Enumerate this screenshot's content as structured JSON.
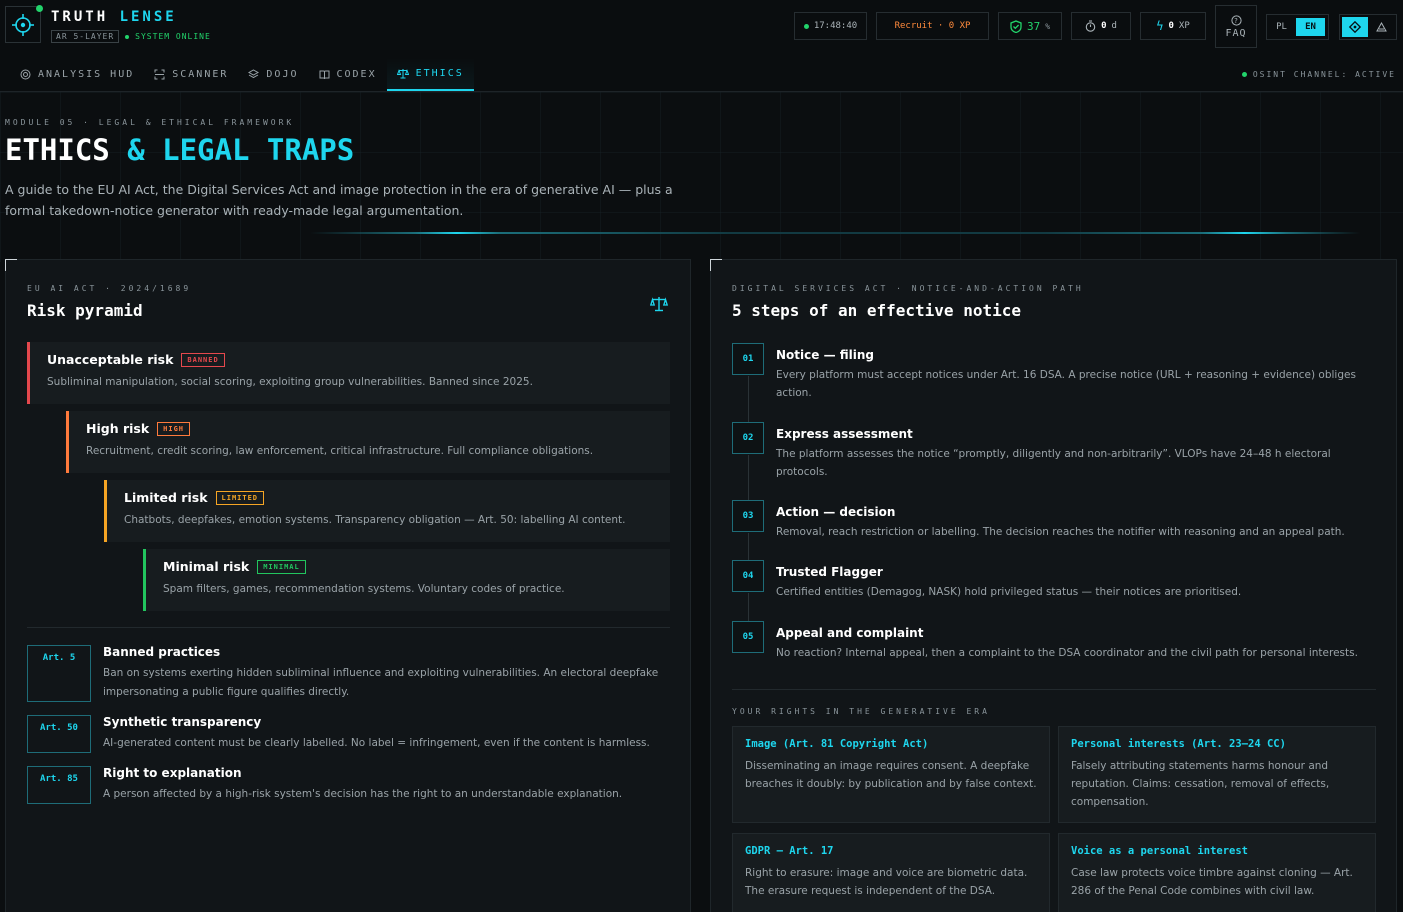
{
  "header": {
    "brand_main": "TRUTH ",
    "brand_accent": "LENSE",
    "layer_tag": "AR 5-LAYER",
    "system_status": "SYSTEM ONLINE",
    "time": "17:48:40",
    "rank": "Recruit · 0 XP",
    "score": "37",
    "score_unit": "%",
    "streak": "0",
    "streak_unit": "d",
    "xp": "0",
    "xp_unit": "XP",
    "faq": "FAQ",
    "lang_pl": "PL",
    "lang_en": "EN",
    "colors": {
      "accent": "#1ed6ee",
      "online": "#22d36b",
      "warning": "#ff8a3c"
    }
  },
  "nav": {
    "items": [
      {
        "label": "ANALYSIS HUD",
        "icon": "target-icon"
      },
      {
        "label": "SCANNER",
        "icon": "scan-icon"
      },
      {
        "label": "DOJO",
        "icon": "layers-icon"
      },
      {
        "label": "CODEX",
        "icon": "book-icon"
      },
      {
        "label": "ETHICS",
        "icon": "scale-icon"
      }
    ],
    "active": "ETHICS",
    "osint": "OSINT CHANNEL: ACTIVE"
  },
  "hero": {
    "module": "MODULE 05 · LEGAL & ETHICAL FRAMEWORK",
    "title_main": "ETHICS ",
    "title_accent": "& LEGAL TRAPS",
    "description": "A guide to the EU AI Act, the Digital Services Act and image protection in the era of generative AI — plus a formal takedown-notice generator with ready-made legal argumentation."
  },
  "left_panel": {
    "kicker": "EU AI ACT · 2024/1689",
    "title": "Risk pyramid",
    "tiers": [
      {
        "name": "Unacceptable risk",
        "badge": "BANNED",
        "color": "#e5484d",
        "desc": "Subliminal manipulation, social scoring, exploiting group vulnerabilities. Banned since 2025."
      },
      {
        "name": "High risk",
        "badge": "HIGH",
        "color": "#ff7a3c",
        "desc": "Recruitment, credit scoring, law enforcement, critical infrastructure. Full compliance obligations."
      },
      {
        "name": "Limited risk",
        "badge": "LIMITED",
        "color": "#f5a524",
        "desc": "Chatbots, deepfakes, emotion systems. Transparency obligation — Art. 50: labelling AI content."
      },
      {
        "name": "Minimal risk",
        "badge": "MINIMAL",
        "color": "#22c55e",
        "desc": "Spam filters, games, recommendation systems. Voluntary codes of practice."
      }
    ],
    "articles": [
      {
        "tag": "Art. 5",
        "title": "Banned practices",
        "text": "Ban on systems exerting hidden subliminal influence and exploiting vulnerabilities. An electoral deepfake impersonating a public figure qualifies directly."
      },
      {
        "tag": "Art. 50",
        "title": "Synthetic transparency",
        "text": "AI-generated content must be clearly labelled. No label = infringement, even if the content is harmless."
      },
      {
        "tag": "Art. 85",
        "title": "Right to explanation",
        "text": "A person affected by a high-risk system's decision has the right to an understandable explanation."
      }
    ]
  },
  "right_panel": {
    "kicker": "DIGITAL SERVICES ACT · NOTICE-AND-ACTION PATH",
    "title": "5 steps of an effective notice",
    "steps": [
      {
        "num": "01",
        "title": "Notice — filing",
        "text": "Every platform must accept notices under Art. 16 DSA. A precise notice (URL + reasoning + evidence) obliges action."
      },
      {
        "num": "02",
        "title": "Express assessment",
        "text": "The platform assesses the notice “promptly, diligently and non-arbitrarily”. VLOPs have 24–48 h electoral protocols."
      },
      {
        "num": "03",
        "title": "Action — decision",
        "text": "Removal, reach restriction or labelling. The decision reaches the notifier with reasoning and an appeal path."
      },
      {
        "num": "04",
        "title": "Trusted Flagger",
        "text": "Certified entities (Demagog, NASK) hold privileged status — their notices are prioritised."
      },
      {
        "num": "05",
        "title": "Appeal and complaint",
        "text": "No reaction? Internal appeal, then a complaint to the DSA coordinator and the civil path for personal interests."
      }
    ],
    "rights_kicker": "YOUR RIGHTS IN THE GENERATIVE ERA",
    "rights": [
      {
        "title": "Image (Art. 81 Copyright Act)",
        "text": "Disseminating an image requires consent. A deepfake breaches it doubly: by publication and by false context."
      },
      {
        "title": "Personal interests (Art. 23–24 CC)",
        "text": "Falsely attributing statements harms honour and reputation. Claims: cessation, removal of effects, compensation."
      },
      {
        "title": "GDPR — Art. 17",
        "text": "Right to erasure: image and voice are biometric data. The erasure request is independent of the DSA."
      },
      {
        "title": "Voice as a personal interest",
        "text": "Case law protects voice timbre against cloning — Art. 286 of the Penal Code combines with civil law."
      }
    ]
  }
}
